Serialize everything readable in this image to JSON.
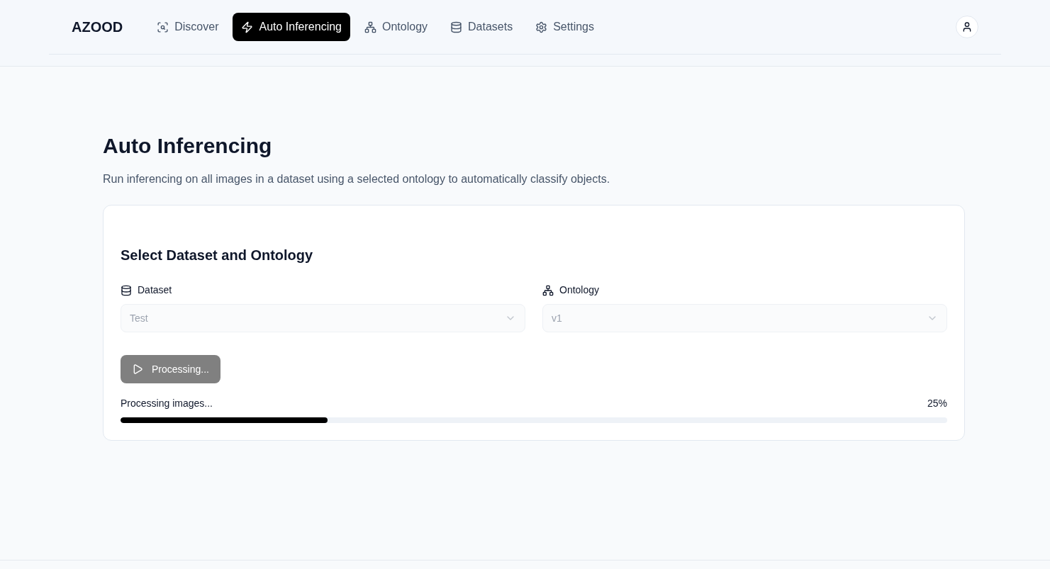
{
  "brand": "AZOOD",
  "nav": [
    {
      "label": "Discover",
      "kind": "scan",
      "selected": false
    },
    {
      "label": "Auto Inferencing",
      "kind": "zap",
      "selected": true
    },
    {
      "label": "Ontology",
      "kind": "network",
      "selected": false
    },
    {
      "label": "Datasets",
      "kind": "database",
      "selected": false
    },
    {
      "label": "Settings",
      "kind": "settings",
      "selected": false
    }
  ],
  "page": {
    "title": "Auto Inferencing",
    "description": "Run inferencing on all images in a dataset using a selected ontology to automatically classify objects."
  },
  "card": {
    "title": "Select Dataset and Ontology",
    "fields": [
      {
        "label": "Dataset",
        "kind": "database",
        "value": "Test",
        "disabled": true
      },
      {
        "label": "Ontology",
        "kind": "network",
        "value": "v1",
        "disabled": true
      }
    ],
    "button": {
      "label": "Processing...",
      "disabled": true
    },
    "progress": {
      "label": "Processing images...",
      "reading": "25%",
      "level": 0.25
    }
  }
}
